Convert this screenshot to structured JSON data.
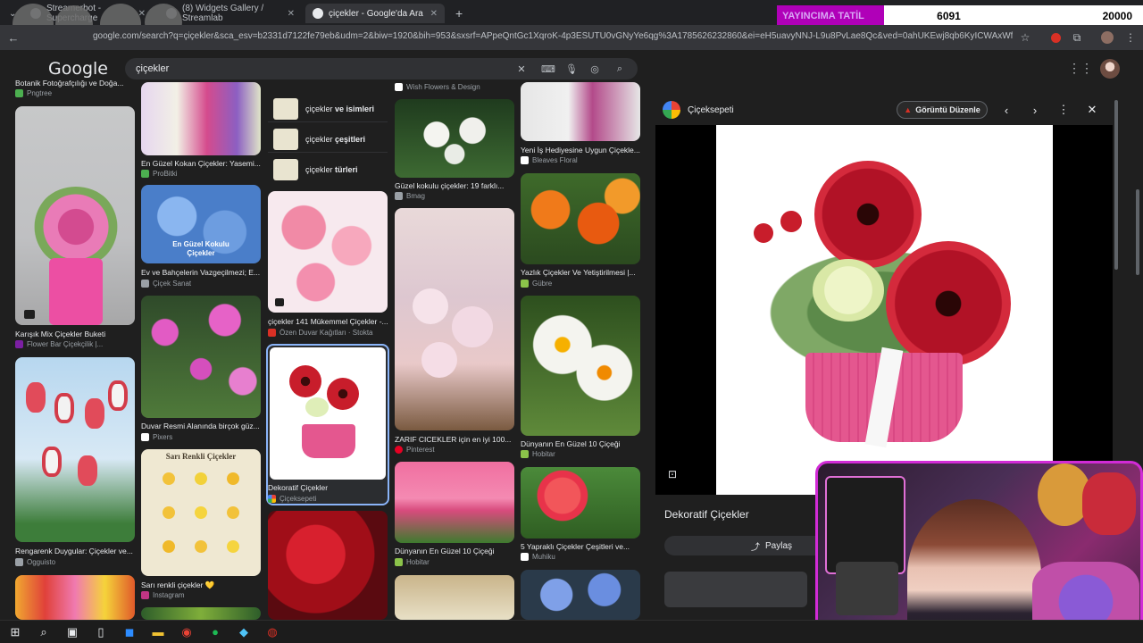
{
  "browser": {
    "tabs": [
      {
        "label": "Streamerbot - Supercharge"
      },
      {
        "label": "(8) Widgets Gallery / Streamlab"
      },
      {
        "label": "çiçekler - Google'da Ara"
      }
    ],
    "new_tab": "+",
    "url": "google.com/search?q=çiçekler&sca_esv=b2331d7122fe79eb&udm=2&biw=1920&bih=953&sxsrf=APpeQntGc1XqroK-4p3ESUTU0vGNyYe6qg%3A1785626232860&ei=eH5uavyNNJ-L9u8PvLae8Qc&ved=0ahUKEwj8qb6KyICWAxWfhf0HHTybJ34Q4d..."
  },
  "stream_overlay": {
    "label": "YAYINCIMA TATİL",
    "current": "6091",
    "goal": "20000"
  },
  "google": {
    "logo": "Google",
    "query": "çiçekler"
  },
  "results": {
    "col1": [
      {
        "title": "Botanik Fotoğrafçılığı ve Doğa...",
        "source": "Pngtree"
      },
      {
        "title": "Karışık Mix Çiçekler Buketi",
        "source": "Flower Bar Çiçekçilik |..."
      },
      {
        "title": "Rengarenk Duygular: Çiçekler ve...",
        "source": "Ogguisto"
      }
    ],
    "col2": [
      {
        "title": "En Güzel Kokan Çiçekler: Yasemi...",
        "source": "ProBitki"
      },
      {
        "title": "Ev ve Bahçelerin Vazgeçilmezi; E...",
        "source": "Çiçek Sanat",
        "overlay": "En Güzel Kokulu Çiçekler"
      },
      {
        "title": "Duvar Resmi Alanında birçok güz...",
        "source": "Pixers"
      },
      {
        "title": "Sarı renkli çiçekler 💛",
        "source": "Instagram",
        "overlay": "Sarı Renkli Çiçekler"
      }
    ],
    "col3_related": [
      {
        "plain": "çiçekler",
        "bold": "ve isimleri"
      },
      {
        "plain": "çiçekler",
        "bold": "çeşitleri"
      },
      {
        "plain": "çiçekler",
        "bold": "türleri"
      }
    ],
    "col3": [
      {
        "title": "çiçekler 141 Mükemmel Çiçekler -...",
        "source": "Özen Duvar Kağıtları · Stokta"
      },
      {
        "title": "Dekoratif Çiçekler",
        "source": "Çiçeksepeti"
      }
    ],
    "col4": [
      {
        "title": "",
        "source": "Wish Flowers & Design"
      },
      {
        "title": "Güzel kokulu çiçekler: 19 farklı...",
        "source": "Bmag"
      },
      {
        "title": "ZARIF CICEKLER için en iyi 100...",
        "source": "Pinterest"
      },
      {
        "title": "Dünyanın En Güzel 10 Çiçeği",
        "source": "Hobitar"
      }
    ],
    "col5": [
      {
        "title": "Yeni İş Hediyesine Uygun Çiçekle...",
        "source": "Bleaves Floral"
      },
      {
        "title": "Yazlık Çiçekler Ve Yetiştirilmesi |...",
        "source": "Gübre"
      },
      {
        "title": "Dünyanın En Güzel 10 Çiçeği",
        "source": "Hobitar"
      },
      {
        "title": "5 Yapraklı Çiçekler Çeşitleri ve...",
        "source": "Muhiku"
      }
    ]
  },
  "preview": {
    "source": "Çiçeksepeti",
    "edit_button": "Görüntü Düzenle",
    "title": "Dekoratif Çiçekler",
    "share": "Paylaş"
  },
  "colors": {
    "accent_magenta": "#d12bd6",
    "overlay_purple": "#b000b8"
  }
}
